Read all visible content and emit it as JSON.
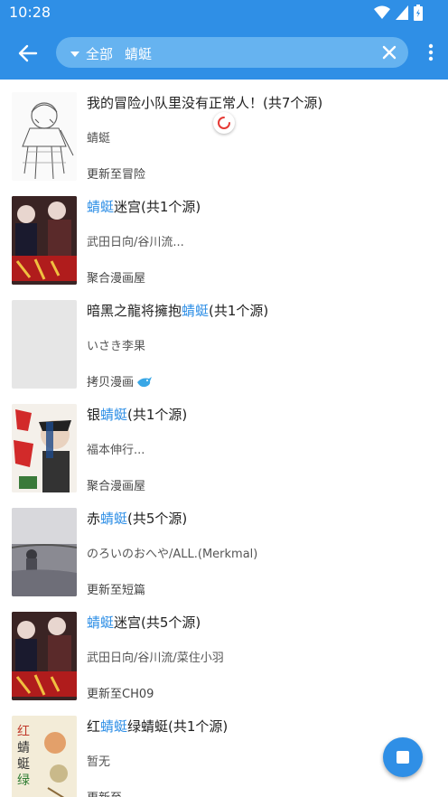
{
  "status": {
    "time": "10:28"
  },
  "search": {
    "scope": "全部",
    "query": "蜻蜓"
  },
  "results": [
    {
      "title_pre": "我的冒险小队里没有正常人！(共7个源)",
      "title_hl": "",
      "title_post": "",
      "author": "蜻蜓",
      "update": "更新至冒险",
      "cover": "sketch"
    },
    {
      "title_pre": "",
      "title_hl": "蜻蜓",
      "title_post": "迷宫(共1个源)",
      "author": "武田日向/谷川流...",
      "update": "聚合漫画屋",
      "cover": "dark-red"
    },
    {
      "title_pre": "暗黑之龍将擁抱",
      "title_hl": "蜻蜓",
      "title_post": "(共1个源)",
      "author": "いさき李果",
      "update": "拷贝漫画",
      "cover": "blank",
      "source_icon": "copy-manga-icon"
    },
    {
      "title_pre": "银",
      "title_hl": "蜻蜓",
      "title_post": "(共1个源)",
      "author": "福本伸行...",
      "update": "聚合漫画屋",
      "cover": "red-white"
    },
    {
      "title_pre": "赤",
      "title_hl": "蜻蜓",
      "title_post": "(共5个源)",
      "author": "のろいのおへや/ALL.(Merkmal)",
      "update": "更新至短篇",
      "cover": "grey-lake"
    },
    {
      "title_pre": "",
      "title_hl": "蜻蜓",
      "title_post": "迷宫(共5个源)",
      "author": "武田日向/谷川流/菜住小羽",
      "update": "更新至CH09",
      "cover": "dark-red"
    },
    {
      "title_pre": "红",
      "title_hl": "蜻蜓",
      "title_post": "绿蜻蜓(共1个源)",
      "author": "暂无",
      "update": "更新至…",
      "cover": "cream"
    }
  ],
  "colors": {
    "primary": "#2f8fe6",
    "highlight": "#2f8fe6"
  }
}
